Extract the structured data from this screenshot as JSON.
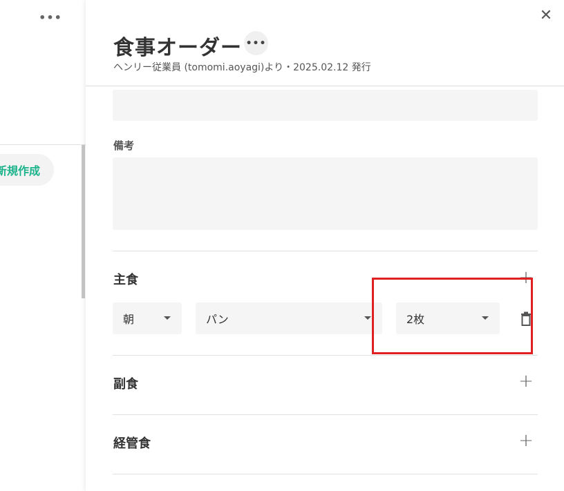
{
  "background": {
    "more_glyph": "•••",
    "new_button_label": "新規作成",
    "accent_color": "#1bb38a"
  },
  "panel": {
    "close_glyph": "✕",
    "title": "食事オーダー",
    "title_more_glyph": "•••",
    "meta": "ヘンリー従業員 (tomomi.aoyagi)より・2025.02.12 発行",
    "notes_label": "備考",
    "notes_value": "",
    "sections": {
      "main_food": {
        "title": "主食",
        "add_glyph": "+",
        "row": {
          "time": "朝",
          "item": "パン",
          "quantity": "2枚"
        }
      },
      "side_food": {
        "title": "副食",
        "add_glyph": "+"
      },
      "tube_food": {
        "title": "経管食",
        "add_glyph": "+"
      }
    }
  },
  "annotation": {
    "highlight_color": "#e02020"
  }
}
